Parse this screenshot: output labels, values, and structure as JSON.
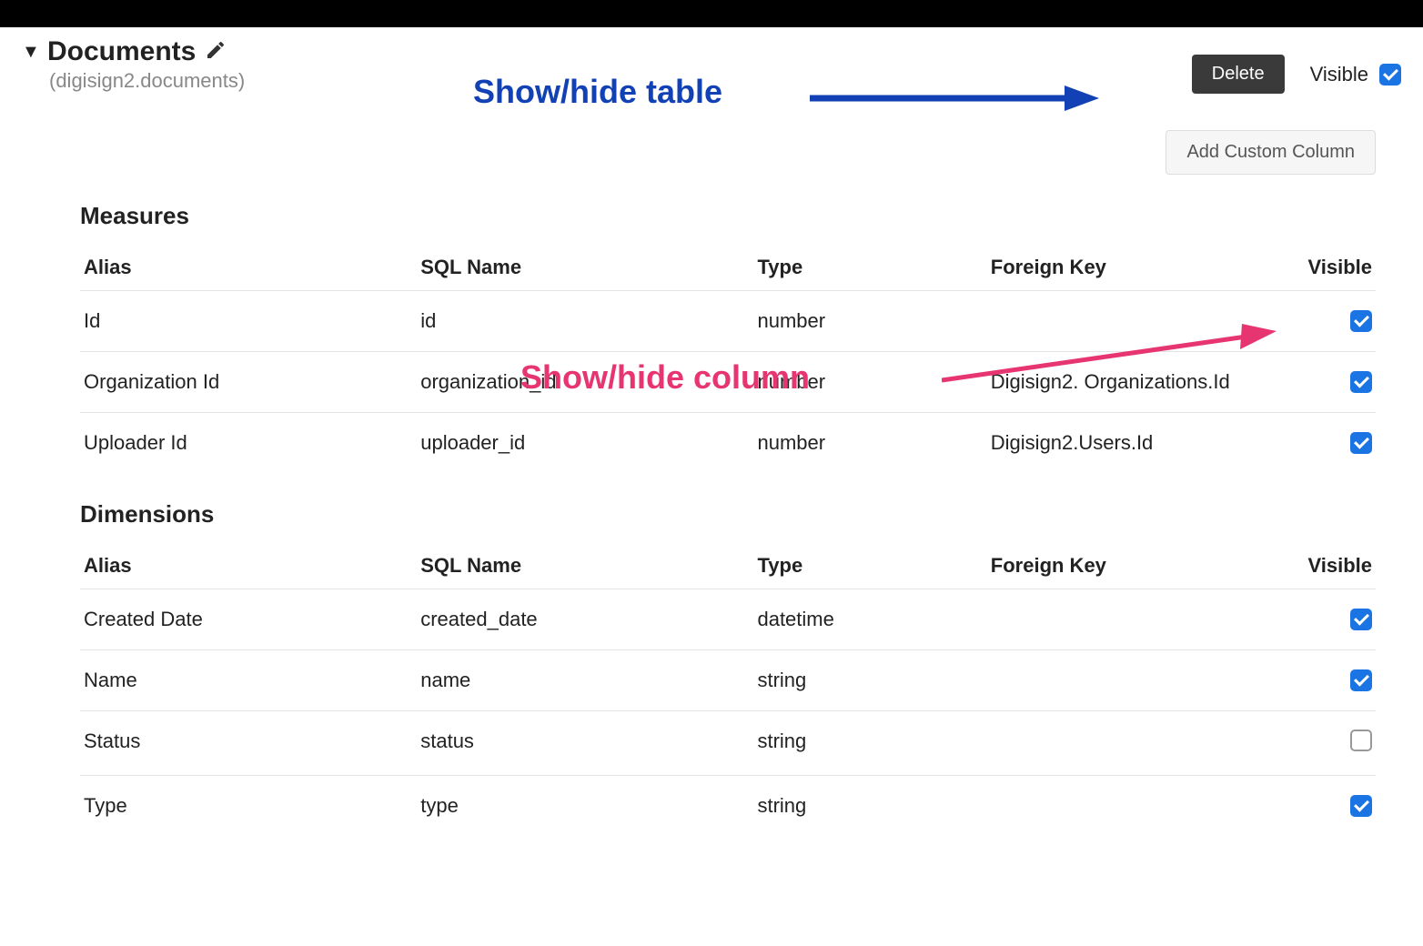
{
  "header": {
    "disclosure_glyph": "▼",
    "title": "Documents",
    "subtitle": "(digisign2.documents)",
    "delete_label": "Delete",
    "visible_label": "Visible",
    "table_visible": true
  },
  "actions": {
    "add_column_label": "Add Custom Column"
  },
  "columns_header": {
    "alias": "Alias",
    "sql_name": "SQL Name",
    "type": "Type",
    "foreign_key": "Foreign Key",
    "visible": "Visible"
  },
  "measures": {
    "section_label": "Measures",
    "rows": [
      {
        "alias": "Id",
        "sql_name": "id",
        "type": "number",
        "foreign_key": "",
        "visible": true
      },
      {
        "alias": "Organization Id",
        "sql_name": "organization_id",
        "type": "number",
        "foreign_key": "Digisign2. Organizations.Id",
        "visible": true
      },
      {
        "alias": "Uploader Id",
        "sql_name": "uploader_id",
        "type": "number",
        "foreign_key": "Digisign2.Users.Id",
        "visible": true
      }
    ]
  },
  "dimensions": {
    "section_label": "Dimensions",
    "rows": [
      {
        "alias": "Created Date",
        "sql_name": "created_date",
        "type": "datetime",
        "foreign_key": "",
        "visible": true
      },
      {
        "alias": "Name",
        "sql_name": "name",
        "type": "string",
        "foreign_key": "",
        "visible": true
      },
      {
        "alias": "Status",
        "sql_name": "status",
        "type": "string",
        "foreign_key": "",
        "visible": false
      },
      {
        "alias": "Type",
        "sql_name": "type",
        "type": "string",
        "foreign_key": "",
        "visible": true
      }
    ]
  },
  "annotations": {
    "show_hide_table": "Show/hide table",
    "show_hide_column": "Show/hide column"
  }
}
